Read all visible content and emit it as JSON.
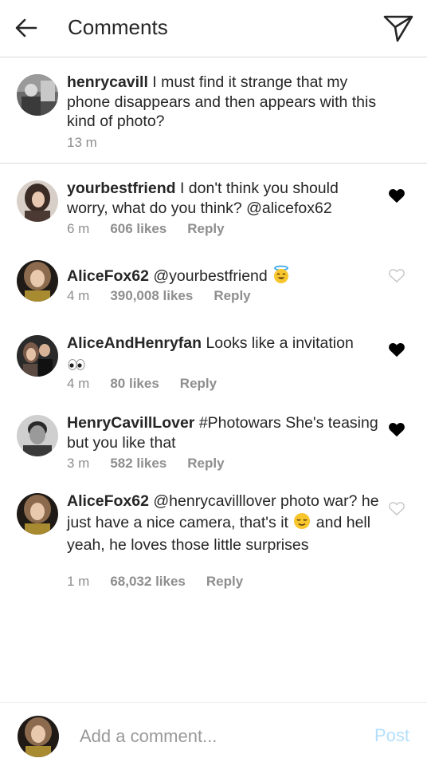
{
  "header": {
    "title": "Comments",
    "back_icon": "arrow-left-icon",
    "send_icon": "paper-plane-icon"
  },
  "caption": {
    "username": "henrycavill",
    "text": " I must find it strange that my phone disappears and then appears with this kind of photo?",
    "time": "13 m"
  },
  "comments": [
    {
      "username": "yourbestfriend",
      "text": " I don't think you should worry, what do you think? @alicefox62",
      "time": "6 m",
      "likes": "606 likes",
      "reply": "Reply",
      "liked": true
    },
    {
      "username": "AliceFox62",
      "text": " @yourbestfriend ",
      "emoji": "smiling-face-with-halo",
      "time": "4 m",
      "likes": "390,008 likes",
      "reply": "Reply",
      "liked": false
    },
    {
      "username": "AliceAndHenryfan",
      "text": " Looks like a invitation",
      "emoji": "eyes",
      "time": "4 m",
      "likes": "80 likes",
      "reply": "Reply",
      "liked": true
    },
    {
      "username": "HenryCavillLover",
      "text": " #Photowars She's teasing but you like that",
      "time": "3 m",
      "likes": "582 likes",
      "reply": "Reply",
      "liked": true
    },
    {
      "username": "AliceFox62",
      "text_before": " @henrycavilllover photo war? he just have a nice camera, that's it ",
      "emoji": "relieved-face",
      "text_after": " and hell yeah, he loves those little surprises",
      "time": "1 m",
      "likes": "68,032 likes",
      "reply": "Reply",
      "liked": false
    }
  ],
  "footer": {
    "placeholder": "Add a comment...",
    "post_label": "Post"
  },
  "colors": {
    "text": "#262626",
    "meta": "#8e8e8e",
    "divider": "#dbdbdb",
    "post_disabled": "#b2dffc",
    "heart_filled": "#000000",
    "heart_outline": "#c7c7c7"
  }
}
